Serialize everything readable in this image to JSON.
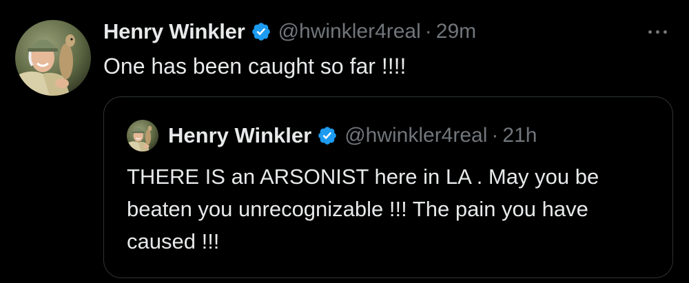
{
  "tweet": {
    "author_name": "Henry Winkler",
    "handle": "@hwinkler4real",
    "separator": "·",
    "time": "29m",
    "text": "One has been caught so far !!!!",
    "verified_color": "#1d9bf0",
    "avatar_icon": "profile-photo-with-meerkat"
  },
  "quoted_tweet": {
    "author_name": "Henry Winkler",
    "handle": "@hwinkler4real",
    "separator": "·",
    "time": "21h",
    "text": "THERE IS an ARSONIST here in LA . May you be beaten you unrecognizable !!! The pain you have caused !!!",
    "avatar_icon": "profile-photo-with-meerkat"
  },
  "menu": {
    "icon": "more-dots-icon"
  },
  "colors": {
    "background": "#000000",
    "primary_text": "#e7e9ea",
    "secondary_text": "#71767b",
    "border": "#2f3336",
    "accent": "#1d9bf0"
  }
}
